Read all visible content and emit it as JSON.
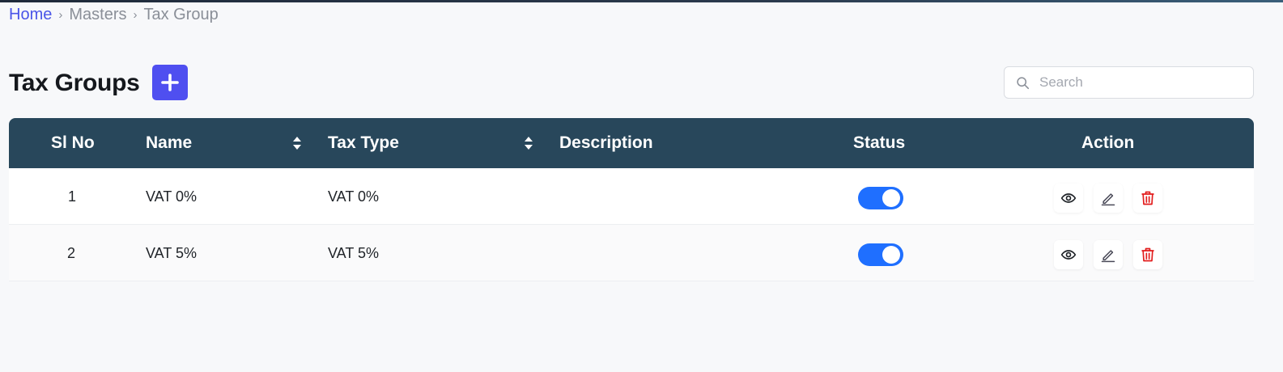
{
  "breadcrumb": {
    "home": "Home",
    "masters": "Masters",
    "current": "Tax Group",
    "separator": "›"
  },
  "page": {
    "title": "Tax Groups",
    "add_icon": "plus-icon"
  },
  "search": {
    "placeholder": "Search",
    "value": "",
    "icon": "search-icon"
  },
  "table": {
    "columns": {
      "sl_no": "Sl No",
      "name": "Name",
      "tax_type": "Tax Type",
      "description": "Description",
      "status": "Status",
      "action": "Action"
    },
    "rows": [
      {
        "sl_no": "1",
        "name": "VAT 0%",
        "tax_type": "VAT 0%",
        "description": "",
        "status": "on"
      },
      {
        "sl_no": "2",
        "name": "VAT 5%",
        "tax_type": "VAT 5%",
        "description": "",
        "status": "on"
      }
    ],
    "action_icons": [
      "eye-icon",
      "edit-icon",
      "trash-icon"
    ]
  },
  "colors": {
    "accent": "#4f4ff0",
    "header_bg": "#28475b",
    "toggle_on": "#1f6fff",
    "delete": "#e21b1b",
    "link": "#4a55e8"
  }
}
